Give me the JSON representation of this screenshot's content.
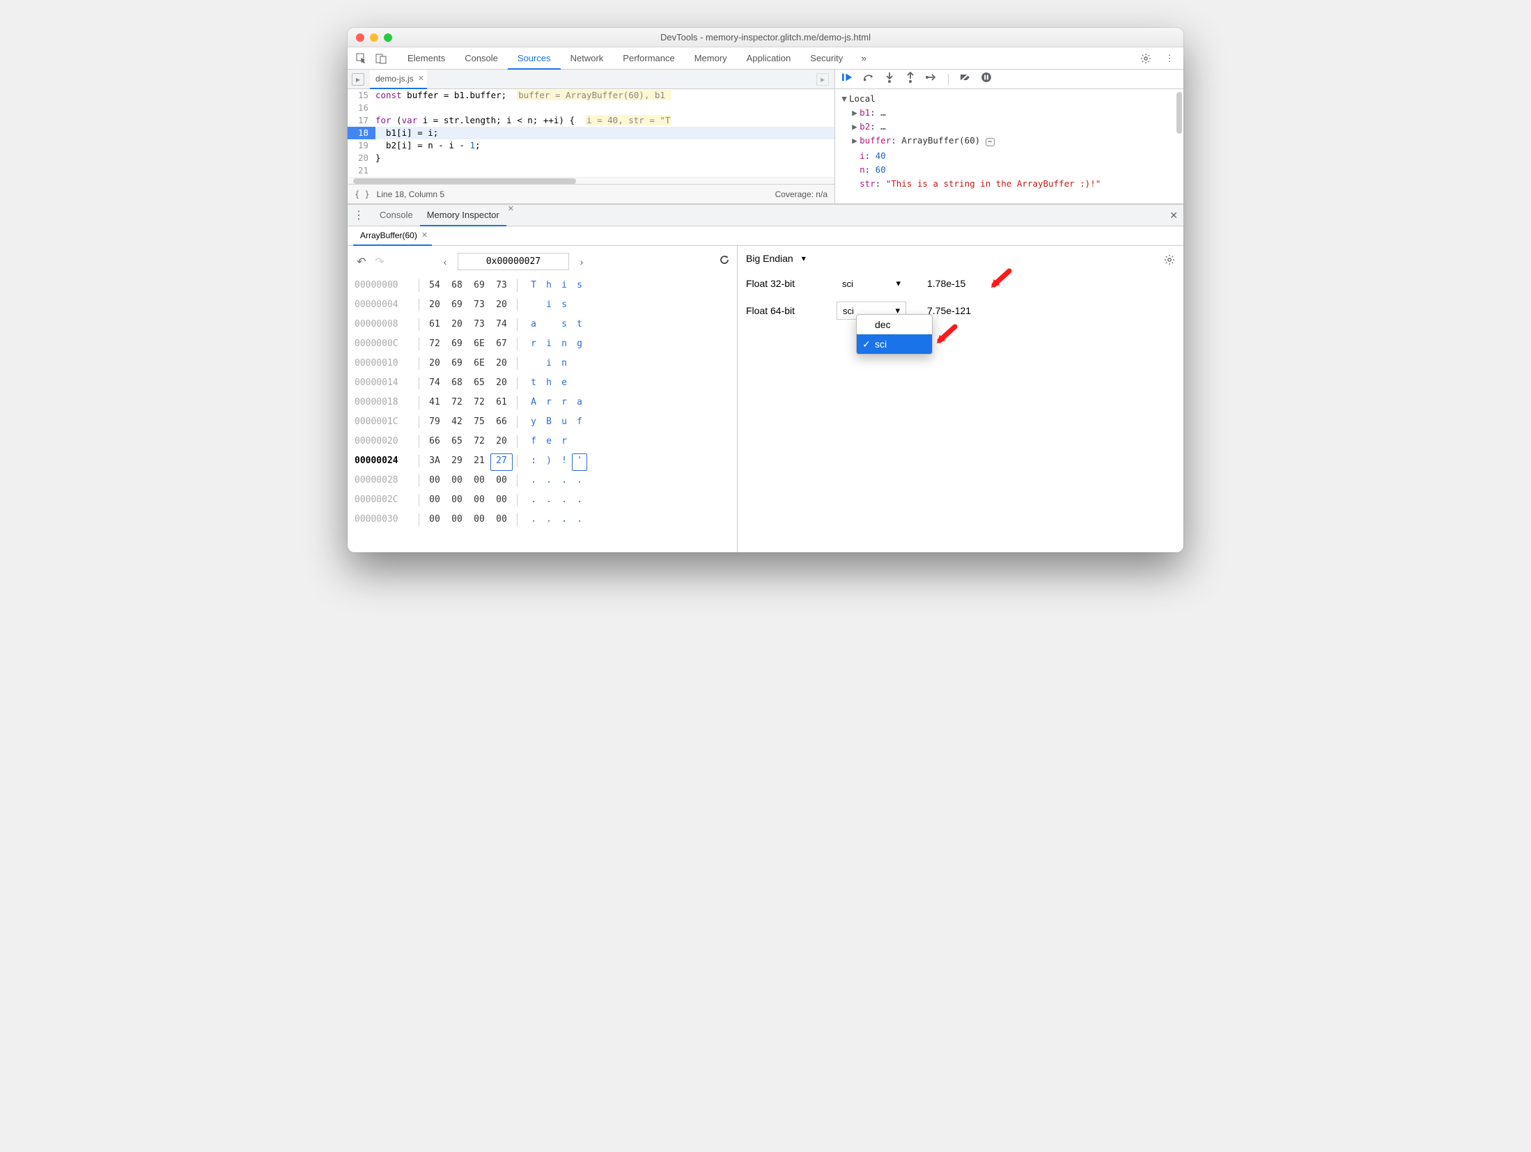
{
  "window": {
    "title": "DevTools - memory-inspector.glitch.me/demo-js.html"
  },
  "tabs": {
    "items": [
      "Elements",
      "Console",
      "Sources",
      "Network",
      "Performance",
      "Memory",
      "Application",
      "Security"
    ],
    "active_index": 2,
    "more": "»"
  },
  "file_tab": {
    "name": "demo-js.js"
  },
  "code": {
    "lines": [
      {
        "n": 15,
        "html": "<span class='kw'>const</span> buffer = b1.buffer;  <span class='cm'>buffer = ArrayBuffer(60), b1 </span>"
      },
      {
        "n": 16,
        "html": ""
      },
      {
        "n": 17,
        "html": "<span class='kw'>for</span> (<span class='kw'>var</span> i = str.length; i &lt; n; ++i) {  <span class='cm'>i = 40, str = \"T</span>"
      },
      {
        "n": 18,
        "html": "  b1[i] = i;",
        "active": true
      },
      {
        "n": 19,
        "html": "  b2[i] = n - i - <span class='num'>1</span>;"
      },
      {
        "n": 20,
        "html": "}"
      },
      {
        "n": 21,
        "html": ""
      }
    ]
  },
  "status": {
    "pos": "Line 18, Column 5",
    "coverage": "Coverage: n/a"
  },
  "dbg_icons": [
    "resume",
    "step-over",
    "step-into",
    "step-out",
    "step",
    "deactivate",
    "pause-exceptions"
  ],
  "scope": {
    "title": "Local",
    "rows": [
      {
        "indent": 1,
        "tri": "▶",
        "key": "b1",
        "val": "…",
        "type": "obj"
      },
      {
        "indent": 1,
        "tri": "▶",
        "key": "b2",
        "val": "…",
        "type": "obj"
      },
      {
        "indent": 1,
        "tri": "▶",
        "key": "buffer",
        "val": "ArrayBuffer(60)",
        "type": "obj",
        "icon": true
      },
      {
        "indent": 1,
        "tri": " ",
        "key": "i",
        "val": "40",
        "type": "num"
      },
      {
        "indent": 1,
        "tri": " ",
        "key": "n",
        "val": "60",
        "type": "num"
      },
      {
        "indent": 1,
        "tri": " ",
        "key": "str",
        "val": "\"This is a string in the ArrayBuffer :)!\"",
        "type": "str"
      }
    ]
  },
  "drawer": {
    "tabs": [
      "Console",
      "Memory Inspector"
    ],
    "active_index": 1
  },
  "mi": {
    "tab_label": "ArrayBuffer(60)",
    "address": "0x00000027",
    "rows": [
      {
        "addr": "00000000",
        "bytes": [
          "54",
          "68",
          "69",
          "73"
        ],
        "ascii": [
          "T",
          "h",
          "i",
          "s"
        ]
      },
      {
        "addr": "00000004",
        "bytes": [
          "20",
          "69",
          "73",
          "20"
        ],
        "ascii": [
          " ",
          "i",
          "s",
          " "
        ]
      },
      {
        "addr": "00000008",
        "bytes": [
          "61",
          "20",
          "73",
          "74"
        ],
        "ascii": [
          "a",
          " ",
          "s",
          "t"
        ]
      },
      {
        "addr": "0000000C",
        "bytes": [
          "72",
          "69",
          "6E",
          "67"
        ],
        "ascii": [
          "r",
          "i",
          "n",
          "g"
        ]
      },
      {
        "addr": "00000010",
        "bytes": [
          "20",
          "69",
          "6E",
          "20"
        ],
        "ascii": [
          " ",
          "i",
          "n",
          " "
        ]
      },
      {
        "addr": "00000014",
        "bytes": [
          "74",
          "68",
          "65",
          "20"
        ],
        "ascii": [
          "t",
          "h",
          "e",
          " "
        ]
      },
      {
        "addr": "00000018",
        "bytes": [
          "41",
          "72",
          "72",
          "61"
        ],
        "ascii": [
          "A",
          "r",
          "r",
          "a"
        ]
      },
      {
        "addr": "0000001C",
        "bytes": [
          "79",
          "42",
          "75",
          "66"
        ],
        "ascii": [
          "y",
          "B",
          "u",
          "f"
        ]
      },
      {
        "addr": "00000020",
        "bytes": [
          "66",
          "65",
          "72",
          "20"
        ],
        "ascii": [
          "f",
          "e",
          "r",
          " "
        ]
      },
      {
        "addr": "00000024",
        "bytes": [
          "3A",
          "29",
          "21",
          "27"
        ],
        "ascii": [
          ":",
          ")",
          "!",
          "'"
        ],
        "hl": true,
        "hl_index": 3
      },
      {
        "addr": "00000028",
        "bytes": [
          "00",
          "00",
          "00",
          "00"
        ],
        "ascii": [
          ".",
          ".",
          ".",
          "."
        ]
      },
      {
        "addr": "0000002C",
        "bytes": [
          "00",
          "00",
          "00",
          "00"
        ],
        "ascii": [
          ".",
          ".",
          ".",
          "."
        ]
      },
      {
        "addr": "00000030",
        "bytes": [
          "00",
          "00",
          "00",
          "00"
        ],
        "ascii": [
          ".",
          ".",
          ".",
          "."
        ]
      }
    ]
  },
  "values": {
    "endian": "Big Endian",
    "rows": [
      {
        "label": "Float 32-bit",
        "mode": "sci",
        "result": "1.78e-15"
      },
      {
        "label": "Float 64-bit",
        "mode": "sci",
        "result": "7.75e-121"
      }
    ],
    "dropdown": {
      "options": [
        "dec",
        "sci"
      ],
      "selected": "sci"
    }
  }
}
